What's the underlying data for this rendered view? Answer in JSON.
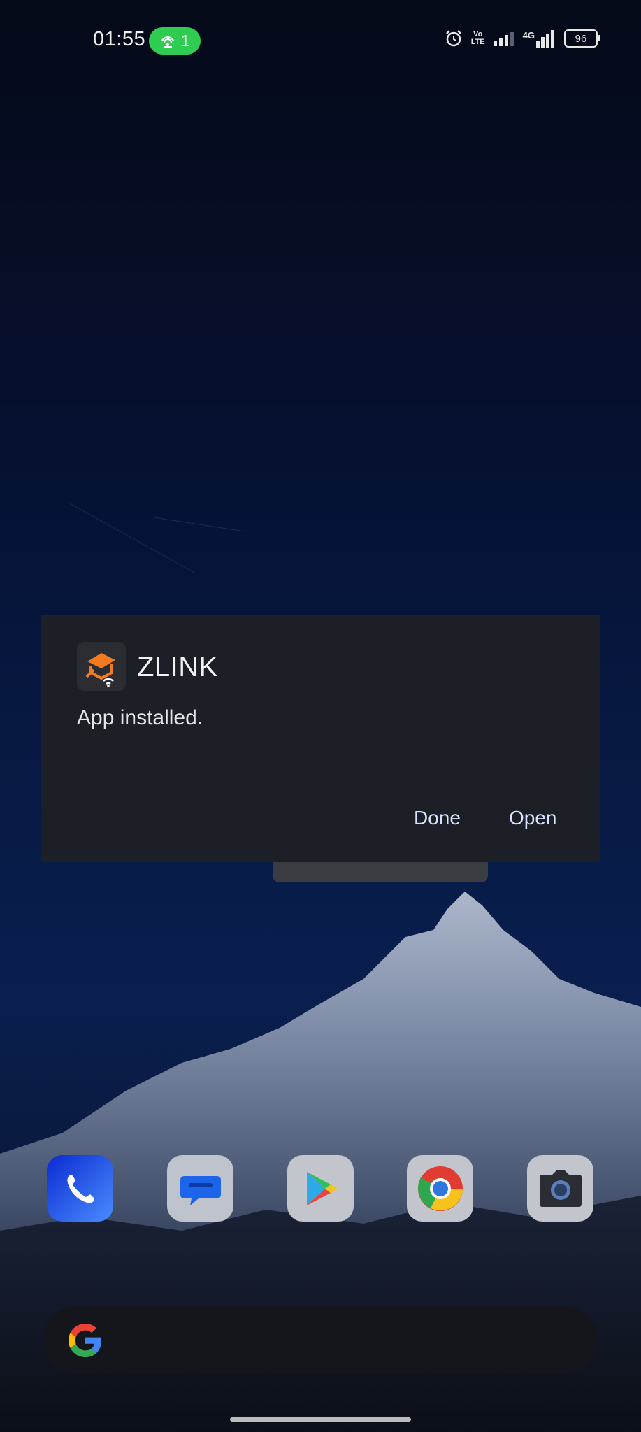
{
  "status_bar": {
    "time": "01:55",
    "hotspot_count": "1",
    "volte_top": "Vo",
    "volte_bottom": "LTE",
    "network_label": "4G",
    "battery": "96",
    "colors": {
      "hotspot_pill": "#2ecc51"
    }
  },
  "dialog": {
    "app_name": "ZLINK",
    "message": "App installed.",
    "done_label": "Done",
    "open_label": "Open",
    "icon": "zlink-app-icon"
  },
  "dock": {
    "apps": [
      {
        "name": "phone",
        "icon": "phone-icon"
      },
      {
        "name": "messages",
        "icon": "messages-icon"
      },
      {
        "name": "play-store",
        "icon": "play-store-icon"
      },
      {
        "name": "chrome",
        "icon": "chrome-icon"
      },
      {
        "name": "camera",
        "icon": "camera-icon"
      }
    ]
  },
  "search": {
    "icon": "google-g-icon"
  }
}
